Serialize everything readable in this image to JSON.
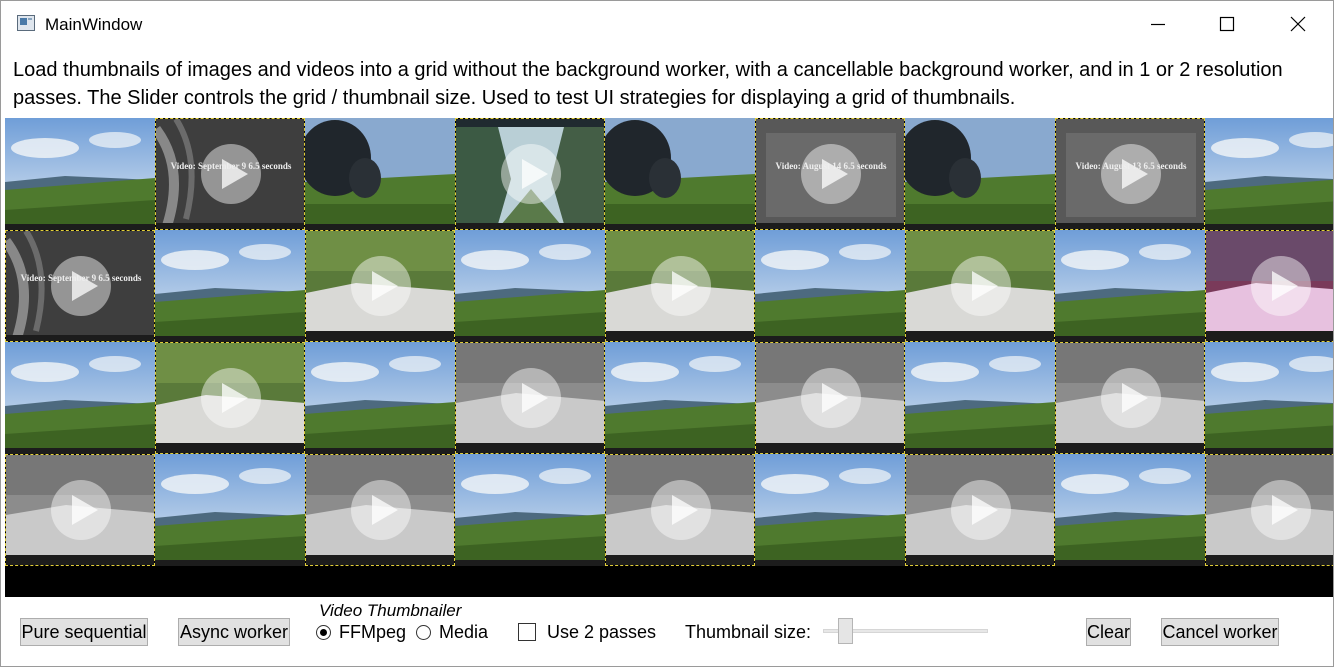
{
  "window": {
    "title": "MainWindow",
    "controls": {
      "minimize": "minimize",
      "maximize": "maximize",
      "close": "close"
    }
  },
  "description": "Load thumbnails of images and videos into a grid without the background worker, with a cancellable background worker, and in 1 or 2 resolution passes. The Slider controls the grid / thumbnail size. Used to test UI strategies for displaying a grid of thumbnails.",
  "grid": {
    "columns": 9,
    "rows": 4,
    "thumbnails": [
      {
        "kind": "image",
        "scene": "sky-meadow",
        "overlay": ""
      },
      {
        "kind": "video",
        "scene": "gray-fern",
        "overlay": "Video: September 9 6.5 seconds"
      },
      {
        "kind": "image",
        "scene": "buffalo",
        "overlay": ""
      },
      {
        "kind": "video",
        "scene": "canyon",
        "overlay": ""
      },
      {
        "kind": "image",
        "scene": "buffalo",
        "overlay": ""
      },
      {
        "kind": "video",
        "scene": "gray-text",
        "overlay": "Video: August 14 6.5 seconds"
      },
      {
        "kind": "image",
        "scene": "buffalo",
        "overlay": ""
      },
      {
        "kind": "video",
        "scene": "gray-text",
        "overlay": "Video: August 13 6.5 seconds"
      },
      {
        "kind": "image",
        "scene": "sky-meadow",
        "overlay": ""
      },
      {
        "kind": "video",
        "scene": "gray-fern",
        "overlay": "Video: September 9 6.5 seconds"
      },
      {
        "kind": "image",
        "scene": "sky-meadow",
        "overlay": ""
      },
      {
        "kind": "video",
        "scene": "rock",
        "overlay": ""
      },
      {
        "kind": "image",
        "scene": "sky-meadow",
        "overlay": ""
      },
      {
        "kind": "video",
        "scene": "rock",
        "overlay": ""
      },
      {
        "kind": "image",
        "scene": "sky-meadow",
        "overlay": ""
      },
      {
        "kind": "video",
        "scene": "rock",
        "overlay": ""
      },
      {
        "kind": "image",
        "scene": "sky-meadow",
        "overlay": ""
      },
      {
        "kind": "video",
        "scene": "pink-rock",
        "overlay": ""
      },
      {
        "kind": "image",
        "scene": "sky-meadow",
        "overlay": ""
      },
      {
        "kind": "video",
        "scene": "rock",
        "overlay": ""
      },
      {
        "kind": "image",
        "scene": "sky-meadow",
        "overlay": ""
      },
      {
        "kind": "video",
        "scene": "gray-rock",
        "overlay": ""
      },
      {
        "kind": "image",
        "scene": "sky-meadow",
        "overlay": ""
      },
      {
        "kind": "video",
        "scene": "gray-rock",
        "overlay": ""
      },
      {
        "kind": "image",
        "scene": "sky-meadow",
        "overlay": ""
      },
      {
        "kind": "video",
        "scene": "gray-rock",
        "overlay": ""
      },
      {
        "kind": "image",
        "scene": "sky-meadow",
        "overlay": ""
      },
      {
        "kind": "video",
        "scene": "gray-rock",
        "overlay": ""
      },
      {
        "kind": "image",
        "scene": "sky-meadow",
        "overlay": ""
      },
      {
        "kind": "video",
        "scene": "gray-rock",
        "overlay": ""
      },
      {
        "kind": "image",
        "scene": "sky-meadow",
        "overlay": ""
      },
      {
        "kind": "video",
        "scene": "gray-rock",
        "overlay": ""
      },
      {
        "kind": "image",
        "scene": "sky-meadow",
        "overlay": ""
      },
      {
        "kind": "video",
        "scene": "gray-rock",
        "overlay": ""
      },
      {
        "kind": "image",
        "scene": "sky-meadow",
        "overlay": ""
      },
      {
        "kind": "video",
        "scene": "gray-rock",
        "overlay": ""
      }
    ]
  },
  "toolbar": {
    "pure_sequential": "Pure sequential",
    "async_worker": "Async worker",
    "thumbnailer_label": "Video Thumbnailer",
    "ffmpeg": "FFMpeg",
    "media": "Media",
    "selected_thumbnailer": "FFMpeg",
    "use_two_passes": "Use 2 passes",
    "use_two_passes_checked": false,
    "thumbnail_size_label": "Thumbnail size:",
    "thumbnail_size_value": 0.1,
    "clear": "Clear",
    "cancel_worker": "Cancel worker"
  },
  "colors": {
    "video_border": "#e2cf3a",
    "grid_background": "#000000",
    "button_face": "#e1e1e1"
  }
}
